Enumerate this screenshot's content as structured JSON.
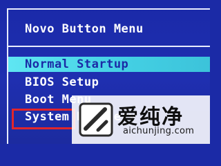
{
  "menu": {
    "title": "Novo Button Menu",
    "items": [
      {
        "label": "Normal Startup",
        "selected": true
      },
      {
        "label": "BIOS Setup",
        "selected": false
      },
      {
        "label": "Boot Menu",
        "selected": false
      },
      {
        "label": "System Recovery",
        "selected": false
      }
    ]
  },
  "watermark": {
    "name": "爱纯净",
    "url": "aichunjing.com"
  },
  "colors": {
    "background": "#1b2aa6",
    "text": "#ffffff",
    "selected_bg": "#4fd8ea",
    "selected_text": "#1b2aa6",
    "highlight_frame": "#e0262b"
  },
  "icons": {
    "logo": "aichunjing-logo-icon"
  }
}
